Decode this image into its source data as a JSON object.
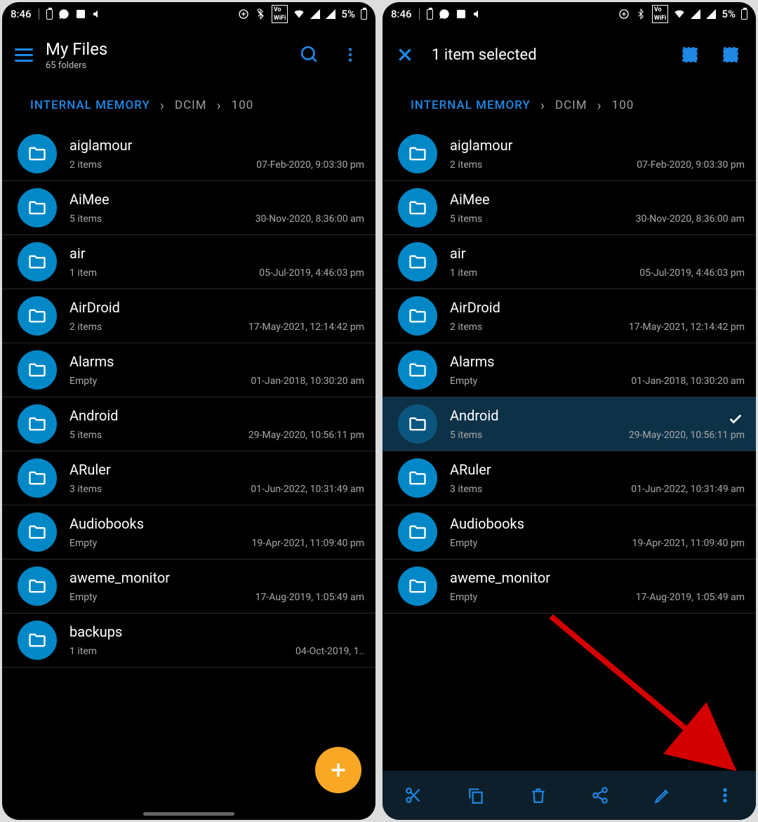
{
  "status": {
    "time": "8:46",
    "battery": "5%"
  },
  "left": {
    "title": "My Files",
    "subtitle": "65 folders",
    "crumbs": {
      "root": "INTERNAL MEMORY",
      "p1": "DCIM",
      "p2": "100"
    }
  },
  "right": {
    "sel_title": "1 item selected",
    "crumbs": {
      "root": "INTERNAL MEMORY",
      "p1": "DCIM",
      "p2": "100"
    },
    "selected_index": 5
  },
  "folders": [
    {
      "name": "aiglamour",
      "count": "2 items",
      "date": "07-Feb-2020, 9:03:30 pm"
    },
    {
      "name": "AiMee",
      "count": "5 items",
      "date": "30-Nov-2020, 8:36:00 am"
    },
    {
      "name": "air",
      "count": "1 item",
      "date": "05-Jul-2019, 4:46:03 pm"
    },
    {
      "name": "AirDroid",
      "count": "2 items",
      "date": "17-May-2021, 12:14:42 pm"
    },
    {
      "name": "Alarms",
      "count": "Empty",
      "date": "01-Jan-2018, 10:30:20 am"
    },
    {
      "name": "Android",
      "count": "5 items",
      "date": "29-May-2020, 10:56:11 pm"
    },
    {
      "name": "ARuler",
      "count": "3 items",
      "date": "01-Jun-2022, 10:31:49 am"
    },
    {
      "name": "Audiobooks",
      "count": "Empty",
      "date": "19-Apr-2021, 11:09:40 pm"
    },
    {
      "name": "aweme_monitor",
      "count": "Empty",
      "date": "17-Aug-2019, 1:05:49 am"
    },
    {
      "name": "backups",
      "count": "1 item",
      "date": "04-Oct-2019, 1.."
    }
  ]
}
